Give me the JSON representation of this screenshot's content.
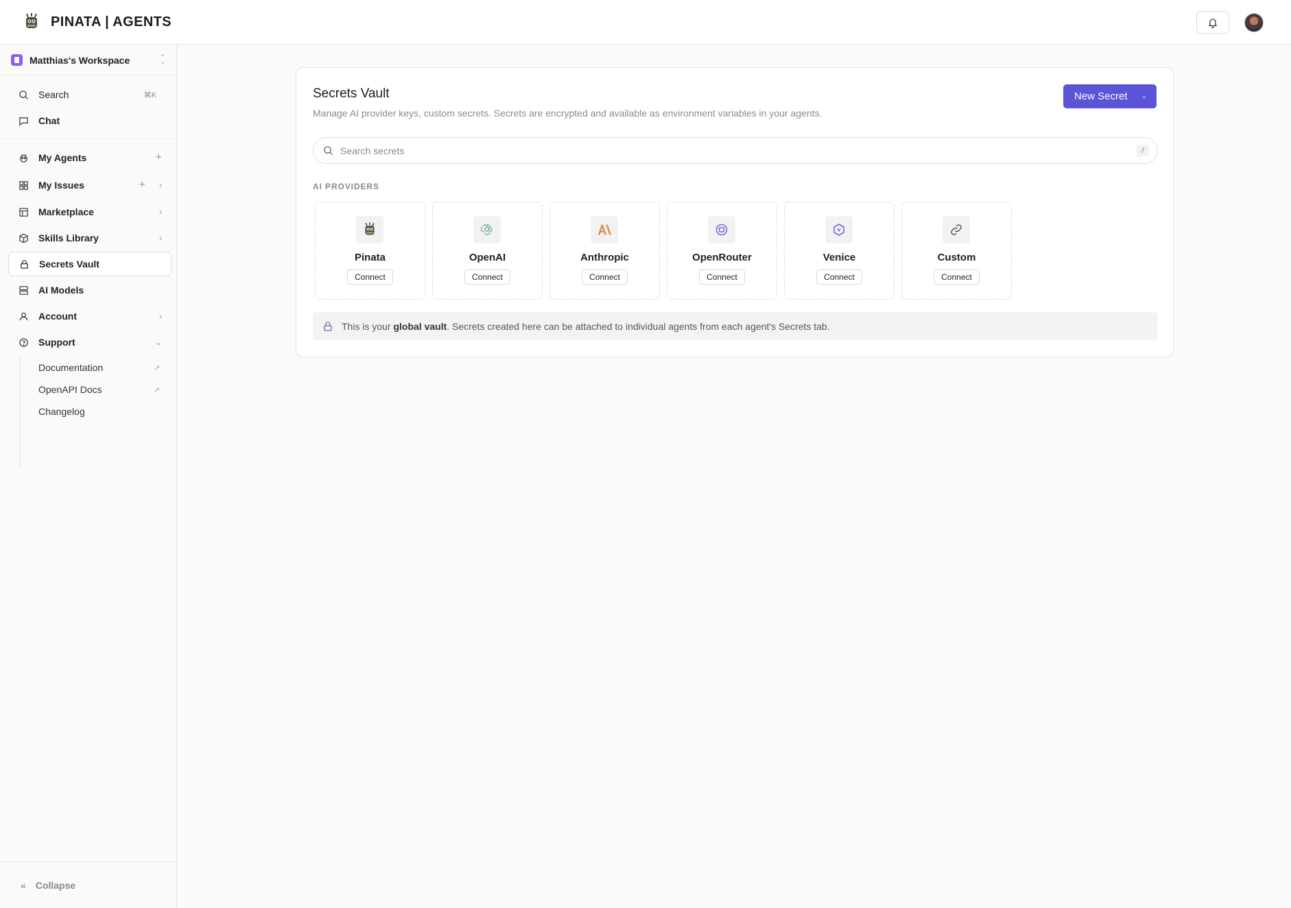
{
  "brand": {
    "title": "PINATA | AGENTS"
  },
  "workspace": {
    "name": "Matthias's Workspace"
  },
  "sidebar": {
    "search": {
      "label": "Search",
      "shortcut": "⌘K"
    },
    "chat": {
      "label": "Chat"
    },
    "items": [
      {
        "label": "My Agents"
      },
      {
        "label": "My Issues"
      },
      {
        "label": "Marketplace"
      },
      {
        "label": "Skills Library"
      },
      {
        "label": "Secrets Vault"
      },
      {
        "label": "AI Models"
      },
      {
        "label": "Account"
      },
      {
        "label": "Support"
      }
    ],
    "support_links": [
      {
        "label": "Documentation"
      },
      {
        "label": "OpenAPI Docs"
      },
      {
        "label": "Changelog"
      }
    ],
    "collapse_label": "Collapse"
  },
  "main": {
    "title": "Secrets Vault",
    "subtitle": "Manage AI provider keys, custom secrets. Secrets are encrypted and available as environment variables in your agents.",
    "new_secret_label": "New Secret",
    "search_placeholder": "Search secrets",
    "search_shortcut": "/",
    "section_label": "AI PROVIDERS",
    "providers": [
      {
        "name": "Pinata",
        "action": "Connect",
        "icon": "pinata-icon"
      },
      {
        "name": "OpenAI",
        "action": "Connect",
        "icon": "openai-icon"
      },
      {
        "name": "Anthropic",
        "action": "Connect",
        "icon": "anthropic-icon"
      },
      {
        "name": "OpenRouter",
        "action": "Connect",
        "icon": "openrouter-icon"
      },
      {
        "name": "Venice",
        "action": "Connect",
        "icon": "venice-icon"
      },
      {
        "name": "Custom",
        "action": "Connect",
        "icon": "link-icon"
      }
    ],
    "notice": {
      "prefix": "This is your ",
      "bold": "global vault",
      "suffix": ". Secrets created here can be attached to individual agents from each agent's Secrets tab."
    }
  },
  "colors": {
    "accent": "#5b54d6",
    "workspace_badge": "#8b5cf6"
  }
}
